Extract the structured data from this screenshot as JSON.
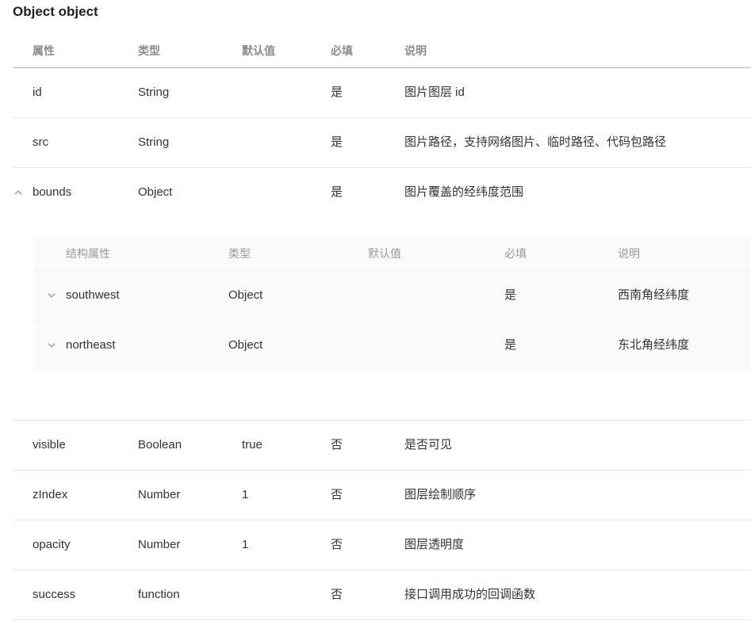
{
  "title": "Object object",
  "colors": {
    "title_text": "#1f1f1f",
    "header_text": "#8c8c8c",
    "body_text": "#333333",
    "header_border": "#b3b3b3",
    "row_border": "#e8e8e8",
    "nested_background": "#fafafa",
    "nested_header_text": "#999999",
    "nested_border": "#efefef",
    "icon": "#8c8c8c"
  },
  "table": {
    "headers": {
      "name": "属性",
      "type": "类型",
      "default": "默认值",
      "required": "必填",
      "description": "说明"
    },
    "rows": [
      {
        "name": "id",
        "type": "String",
        "default": "",
        "required": "是",
        "description": "图片图层 id"
      },
      {
        "name": "src",
        "type": "String",
        "default": "",
        "required": "是",
        "description": "图片路径，支持网络图片、临时路径、代码包路径"
      },
      {
        "name": "bounds",
        "type": "Object",
        "default": "",
        "required": "是",
        "description": "图片覆盖的经纬度范围",
        "expanded": true,
        "toggle_icon": "chevron-up-icon",
        "children": {
          "headers": {
            "name": "结构属性",
            "type": "类型",
            "default": "默认值",
            "required": "必填",
            "description": "说明"
          },
          "rows": [
            {
              "name": "southwest",
              "type": "Object",
              "default": "",
              "required": "是",
              "description": "西南角经纬度",
              "expanded": false,
              "toggle_icon": "chevron-down-icon"
            },
            {
              "name": "northeast",
              "type": "Object",
              "default": "",
              "required": "是",
              "description": "东北角经纬度",
              "expanded": false,
              "toggle_icon": "chevron-down-icon"
            }
          ]
        }
      },
      {
        "name": "visible",
        "type": "Boolean",
        "default": "true",
        "required": "否",
        "description": "是否可见"
      },
      {
        "name": "zIndex",
        "type": "Number",
        "default": "1",
        "required": "否",
        "description": "图层绘制顺序"
      },
      {
        "name": "opacity",
        "type": "Number",
        "default": "1",
        "required": "否",
        "description": "图层透明度"
      },
      {
        "name": "success",
        "type": "function",
        "default": "",
        "required": "否",
        "description": "接口调用成功的回调函数"
      }
    ]
  }
}
